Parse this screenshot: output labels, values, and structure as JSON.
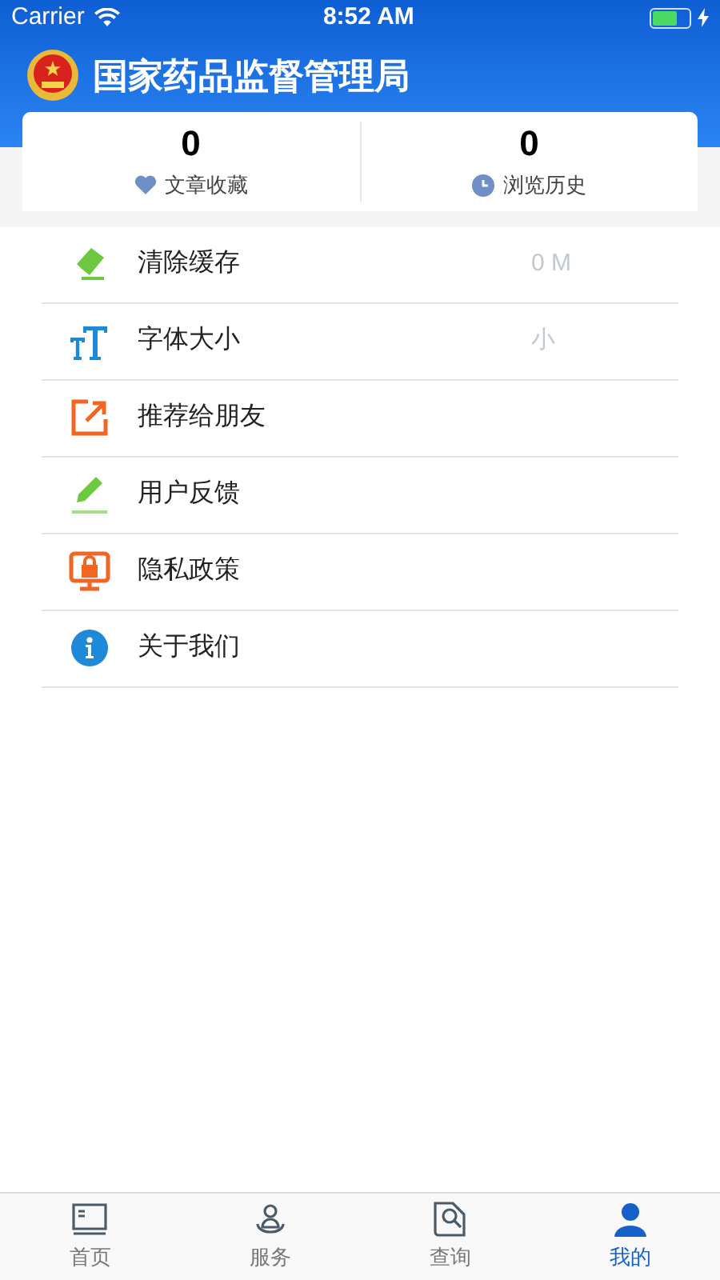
{
  "status_bar": {
    "carrier": "Carrier",
    "time": "8:52 AM"
  },
  "header": {
    "title": "国家药品监督管理局"
  },
  "stats": [
    {
      "count": "0",
      "label": "文章收藏",
      "kind": "heart"
    },
    {
      "count": "0",
      "label": "浏览历史",
      "kind": "clock"
    }
  ],
  "menu": [
    {
      "label": "清除缓存",
      "value": "0 M",
      "kind": "eraser"
    },
    {
      "label": "字体大小",
      "value": "小",
      "kind": "font"
    },
    {
      "label": "推荐给朋友",
      "kind": "share"
    },
    {
      "label": "用户反馈",
      "kind": "pencil"
    },
    {
      "label": "隐私政策",
      "kind": "lock"
    },
    {
      "label": "关于我们",
      "kind": "info"
    }
  ],
  "tab_bar": [
    {
      "label": "首页",
      "kind": "home",
      "selected": false
    },
    {
      "label": "服务",
      "kind": "service",
      "selected": false
    },
    {
      "label": "查询",
      "kind": "search",
      "selected": false
    },
    {
      "label": "我的",
      "kind": "profile",
      "selected": true
    }
  ]
}
